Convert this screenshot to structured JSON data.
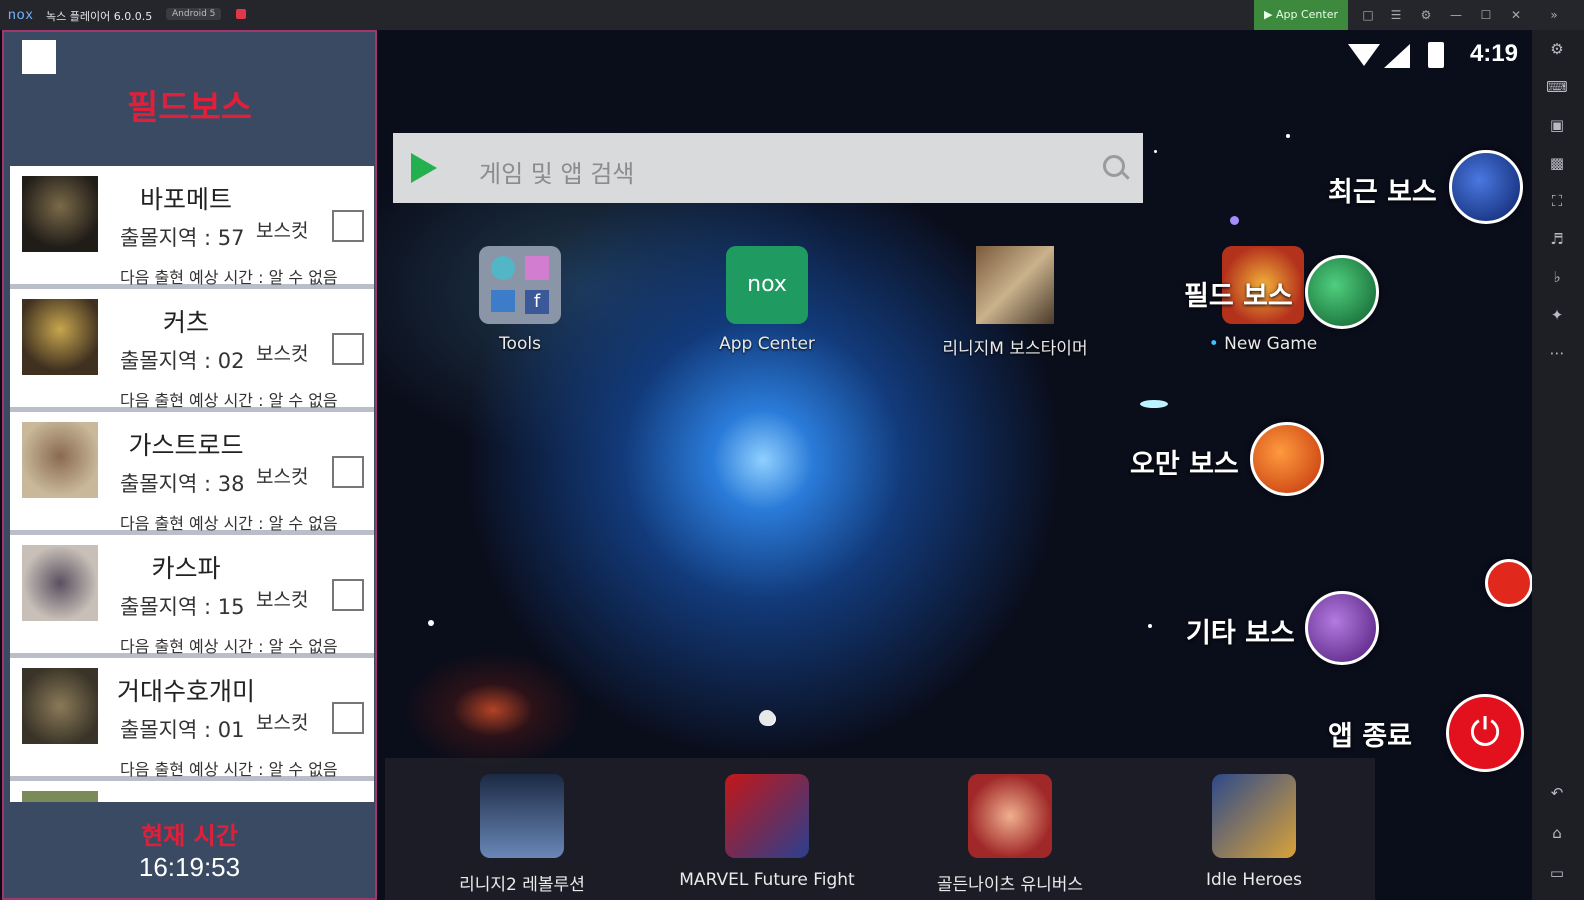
{
  "titlebar": {
    "logo": "nox",
    "title": "녹스 플레이어 6.0.0.5",
    "android_badge": "Android 5",
    "app_center_label": "App Center"
  },
  "status_bar": {
    "time": "4:19"
  },
  "search": {
    "placeholder": "게임 및 앱 검색"
  },
  "desktop_apps": [
    {
      "label": "Tools"
    },
    {
      "label": "App Center"
    },
    {
      "label": "리니지M 보스타이머"
    },
    {
      "label": "New Game"
    }
  ],
  "floating_menu": {
    "recent_boss": "최근 보스",
    "field_boss": "필드 보스",
    "oman_boss": "오만 보스",
    "other_boss": "기타 보스",
    "exit_app": "앱 종료"
  },
  "dock_apps": [
    {
      "label": "리니지2 레볼루션"
    },
    {
      "label": "MARVEL Future Fight"
    },
    {
      "label": "골든나이츠 유니버스"
    },
    {
      "label": "Idle Heroes"
    }
  ],
  "panel": {
    "title": "필드보스",
    "bosses": [
      {
        "name": "바포메트",
        "region": "출몰지역 : 57",
        "cut_label": "보스컷",
        "next": "다음 출현 예상 시간 : 알 수 없음"
      },
      {
        "name": "커츠",
        "region": "출몰지역 : 02",
        "cut_label": "보스컷",
        "next": "다음 출현 예상 시간 : 알 수 없음"
      },
      {
        "name": "가스트로드",
        "region": "출몰지역 : 38",
        "cut_label": "보스컷",
        "next": "다음 출현 예상 시간 : 알 수 없음"
      },
      {
        "name": "카스파",
        "region": "출몰지역 : 15",
        "cut_label": "보스컷",
        "next": "다음 출현 예상 시간 : 알 수 없음"
      },
      {
        "name": "거대수호개미",
        "region": "출몰지역 : 01",
        "cut_label": "보스컷",
        "next": "다음 출현 예상 시간 : 알 수 없음"
      }
    ],
    "current_time_label": "현재 시간",
    "current_time": "16:19:53"
  },
  "colors": {
    "panel_bg": "#3b4a63",
    "panel_title": "#e0203a",
    "recent_boss_ball": "#1d3f9e",
    "field_boss_ball": "#1f8c45",
    "oman_boss_ball": "#e35216",
    "other_boss_ball": "#7a3aa6",
    "exit_button": "#e3101d"
  }
}
